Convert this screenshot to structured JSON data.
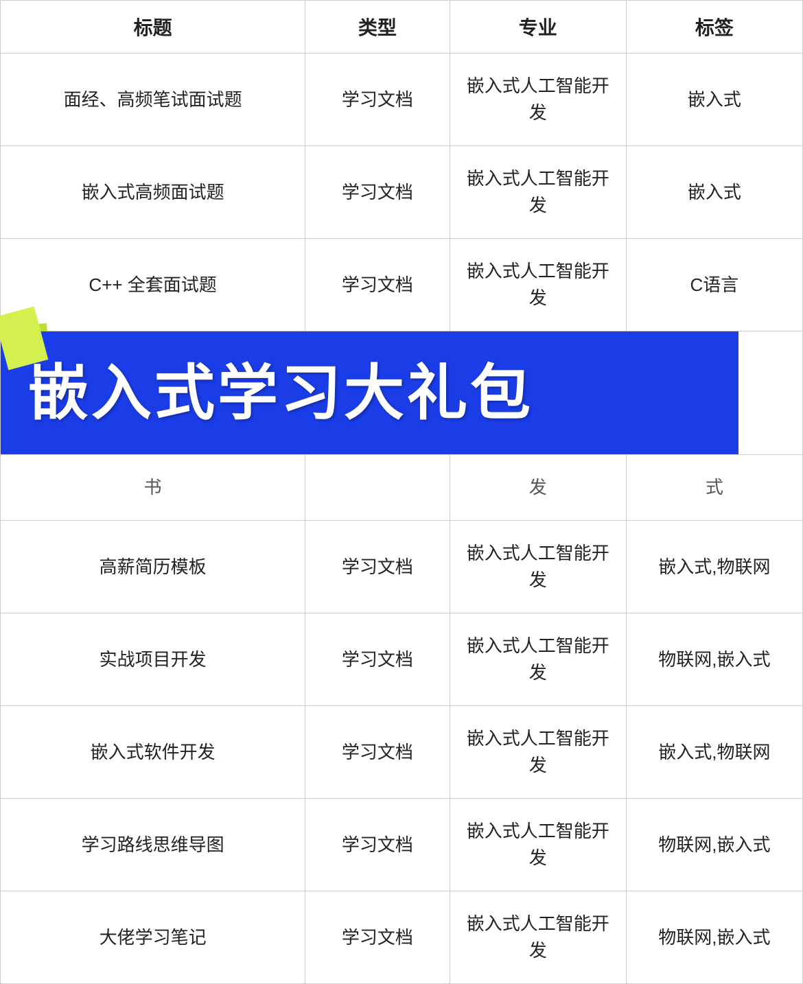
{
  "table": {
    "headers": [
      "标题",
      "类型",
      "专业",
      "标签"
    ],
    "rows": [
      {
        "title": "面经、高频笔试面试题",
        "type": "学习文档",
        "major": "嵌入式人工智能开发",
        "tag": "嵌入式"
      },
      {
        "title": "嵌入式高频面试题",
        "type": "学习文档",
        "major": "嵌入式人工智能开发",
        "tag": "嵌入式"
      },
      {
        "title": "C++ 全套面试题",
        "type": "学习文档",
        "major": "嵌入式人工智能开发",
        "tag": "C语言"
      },
      {
        "title": "banner",
        "type": "",
        "major": "",
        "tag": ""
      },
      {
        "title": "书",
        "type": "",
        "major": "发",
        "tag": "式",
        "partial": true
      },
      {
        "title": "高薪简历模板",
        "type": "学习文档",
        "major": "嵌入式人工智能开发",
        "tag": "嵌入式,物联网"
      },
      {
        "title": "实战项目开发",
        "type": "学习文档",
        "major": "嵌入式人工智能开发",
        "tag": "物联网,嵌入式"
      },
      {
        "title": "嵌入式软件开发",
        "type": "学习文档",
        "major": "嵌入式人工智能开发",
        "tag": "嵌入式,物联网"
      },
      {
        "title": "学习路线思维导图",
        "type": "学习文档",
        "major": "嵌入式人工智能开发",
        "tag": "物联网,嵌入式"
      },
      {
        "title": "大佬学习笔记",
        "type": "学习文档",
        "major": "嵌入式人工智能开发",
        "tag": "物联网,嵌入式"
      }
    ],
    "banner": {
      "text": "嵌入式学习大礼包"
    }
  }
}
